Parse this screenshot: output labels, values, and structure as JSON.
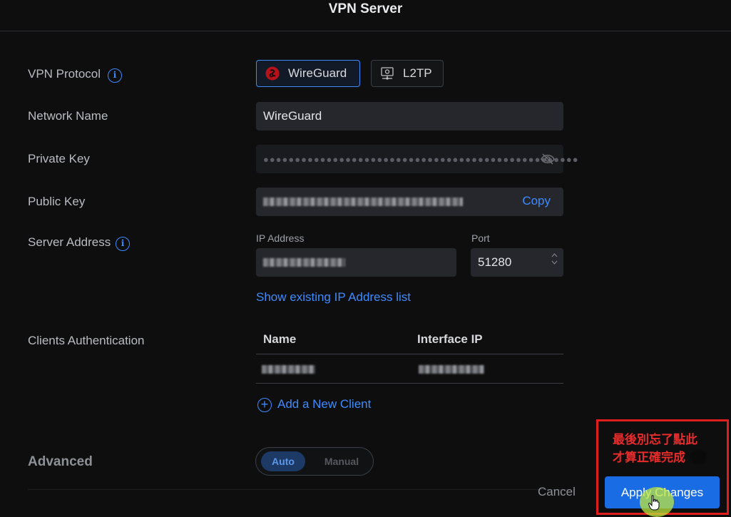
{
  "header": {
    "title": "VPN Server"
  },
  "vpn_protocol": {
    "label": "VPN Protocol",
    "options": [
      {
        "label": "WireGuard",
        "icon": "wireguard-icon",
        "selected": true
      },
      {
        "label": "L2TP",
        "icon": "l2tp-icon",
        "selected": false
      }
    ]
  },
  "network_name": {
    "label": "Network Name",
    "value": "WireGuard"
  },
  "private_key": {
    "label": "Private Key",
    "value": "●●●●●●●●●●●●●●●●●●●●●●●●●●●●●●●●●●●●●●●●●●●●●●●●●●"
  },
  "public_key": {
    "label": "Public Key",
    "copy_label": "Copy"
  },
  "server_address": {
    "label": "Server Address",
    "ip_label": "IP Address",
    "port_label": "Port",
    "port_value": "51280",
    "show_list_link": "Show existing IP Address list"
  },
  "clients": {
    "label": "Clients Authentication",
    "columns": [
      "Name",
      "Interface IP"
    ],
    "add_client_label": "Add a New Client"
  },
  "advanced": {
    "label": "Advanced",
    "options": [
      "Auto",
      "Manual"
    ],
    "selected": "Auto"
  },
  "footer": {
    "cancel_label": "Cancel",
    "apply_label": "Apply Changes"
  },
  "annotation": {
    "text": "最後別忘了點此\n才算正確完成",
    "color": "#e01e1e"
  },
  "colors": {
    "accent": "#1a6ce5",
    "link": "#3d8bff",
    "background": "#0e0e0f"
  }
}
